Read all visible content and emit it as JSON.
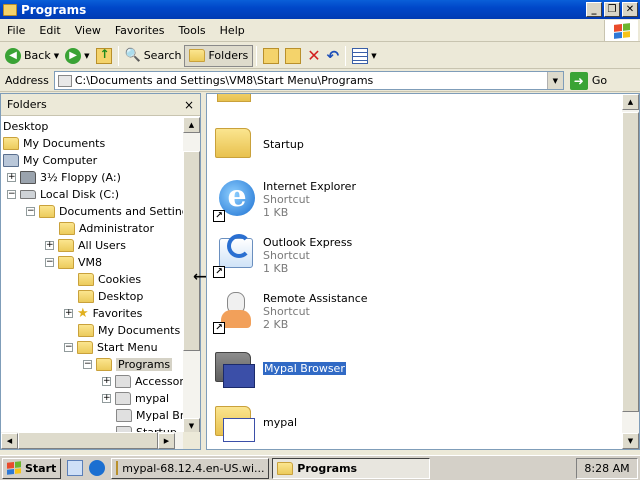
{
  "window": {
    "title": "Programs"
  },
  "menu": [
    "File",
    "Edit",
    "View",
    "Favorites",
    "Tools",
    "Help"
  ],
  "toolbar": {
    "back": "Back",
    "search": "Search",
    "folders": "Folders"
  },
  "address": {
    "label": "Address",
    "value": "C:\\Documents and Settings\\VM8\\Start Menu\\Programs",
    "go": "Go"
  },
  "folders_pane": {
    "title": "Folders",
    "close": "×"
  },
  "tree": [
    {
      "label": "Desktop"
    },
    {
      "label": "My Documents"
    },
    {
      "label": "My Computer"
    },
    {
      "label": "3½ Floppy (A:)"
    },
    {
      "label": "Local Disk (C:)"
    },
    {
      "label": "Documents and Settings"
    },
    {
      "label": "Administrator"
    },
    {
      "label": "All Users"
    },
    {
      "label": "VM8"
    },
    {
      "label": "Cookies"
    },
    {
      "label": "Desktop"
    },
    {
      "label": "Favorites"
    },
    {
      "label": "My Documents"
    },
    {
      "label": "Start Menu"
    },
    {
      "label": "Programs"
    },
    {
      "label": "Accessori"
    },
    {
      "label": "mypal"
    },
    {
      "label": "Mypal Bro"
    },
    {
      "label": "Startup"
    }
  ],
  "items": [
    {
      "name": "Startup",
      "type": "",
      "size": ""
    },
    {
      "name": "Internet Explorer",
      "type": "Shortcut",
      "size": "1 KB"
    },
    {
      "name": "Outlook Express",
      "type": "Shortcut",
      "size": "1 KB"
    },
    {
      "name": "Remote Assistance",
      "type": "Shortcut",
      "size": "2 KB"
    },
    {
      "name": "Mypal Browser",
      "type": "",
      "size": ""
    },
    {
      "name": "mypal",
      "type": "",
      "size": ""
    }
  ],
  "taskbar": {
    "start": "Start",
    "tasks": [
      "mypal-68.12.4.en-US.wi...",
      "Programs"
    ],
    "clock": "8:28 AM"
  }
}
